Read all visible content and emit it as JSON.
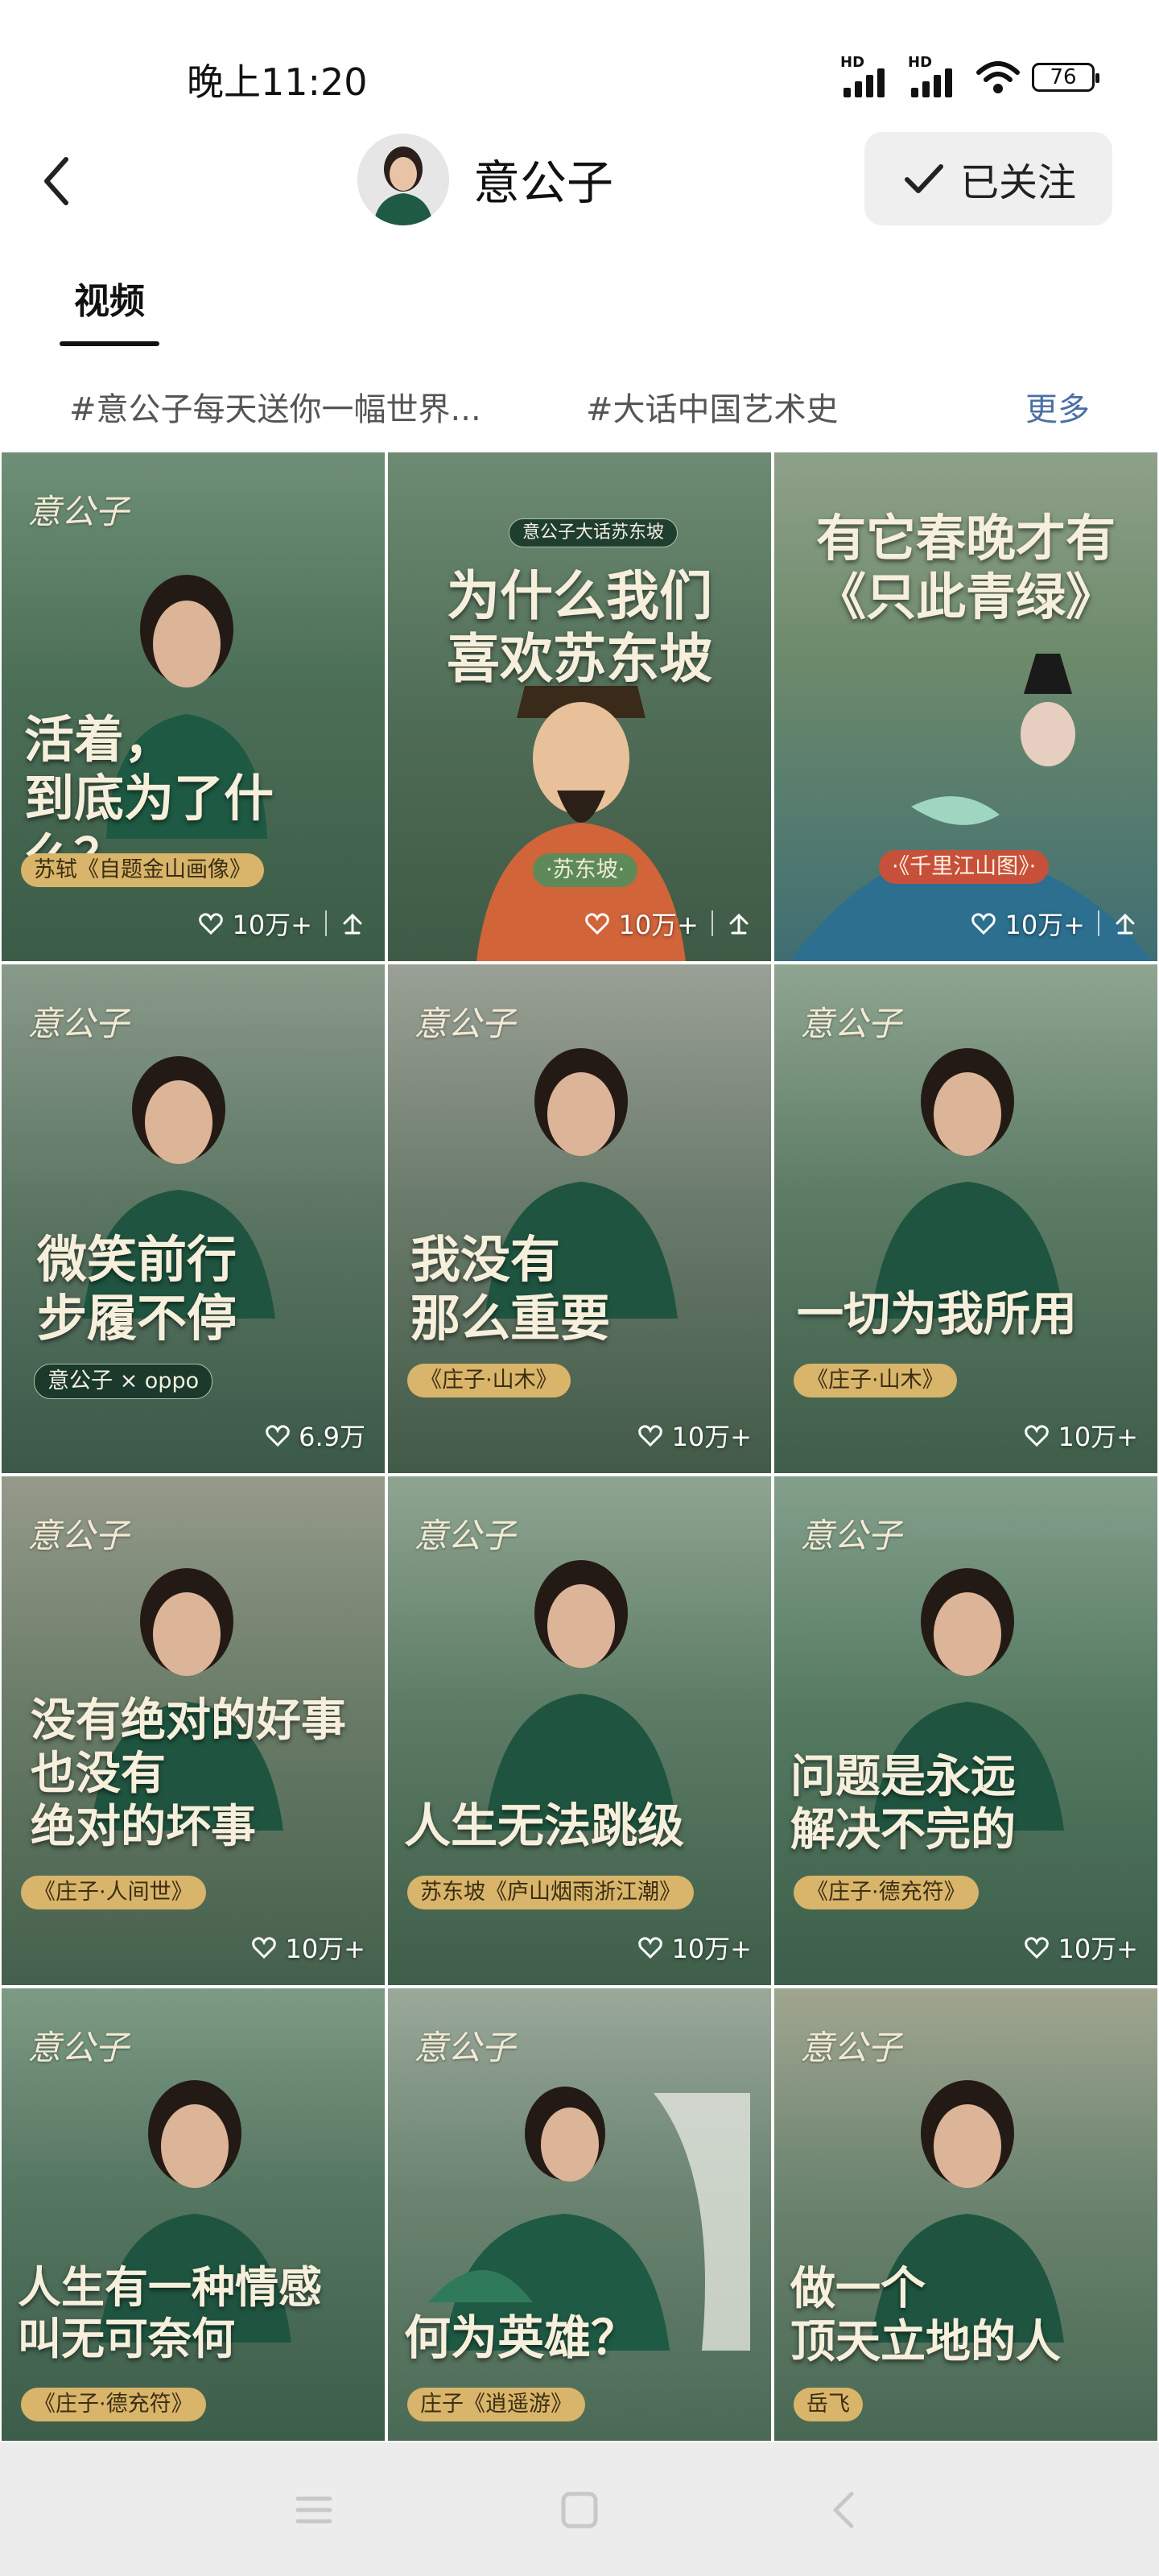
{
  "status": {
    "time": "晚上11:20",
    "signal1_label": "HD",
    "signal2_label": "HD",
    "battery": "76"
  },
  "header": {
    "name": "意公子",
    "follow_label": "已关注"
  },
  "tabs": [
    {
      "label": "视频"
    }
  ],
  "topics": [
    "#意公子每天送你一幅世界...",
    "#大话中国艺术史"
  ],
  "topics_more": "更多",
  "logo_text": "意公子",
  "videos": [
    {
      "headline": "活着，\n到底为了什么？",
      "tag": "苏轼《自题金山画像》",
      "likes": "10万+",
      "share": true
    },
    {
      "top_label": "意公子大话苏东坡",
      "headline": "为什么我们\n喜欢苏东坡",
      "tag": "·苏东坡·",
      "likes": "10万+",
      "share": true
    },
    {
      "headline": "有它春晚才有\n《只此青绿》",
      "tag": "·《千里江山图》·",
      "likes": "10万+",
      "share": true
    },
    {
      "headline": "微笑前行\n步履不停",
      "tag": "意公子 × oppo",
      "likes": "6.9万"
    },
    {
      "headline": "我没有\n那么重要",
      "tag": "《庄子·山木》",
      "likes": "10万+"
    },
    {
      "headline": "一切为我所用",
      "tag": "《庄子·山木》",
      "likes": "10万+"
    },
    {
      "headline": "没有绝对的好事\n也没有\n绝对的坏事",
      "tag": "《庄子·人间世》",
      "likes": "10万+"
    },
    {
      "headline": "人生无法跳级",
      "tag": "苏东坡《庐山烟雨浙江潮》",
      "likes": "10万+"
    },
    {
      "headline": "问题是永远\n解决不完的",
      "tag": "《庄子·德充符》",
      "likes": "10万+"
    },
    {
      "headline": "人生有一种情感\n叫无可奈何",
      "tag": "《庄子·德充符》"
    },
    {
      "headline": "何为英雄？",
      "tag": "庄子《逍遥游》"
    },
    {
      "headline": "做一个\n顶天立地的人",
      "tag": "岳飞"
    }
  ]
}
